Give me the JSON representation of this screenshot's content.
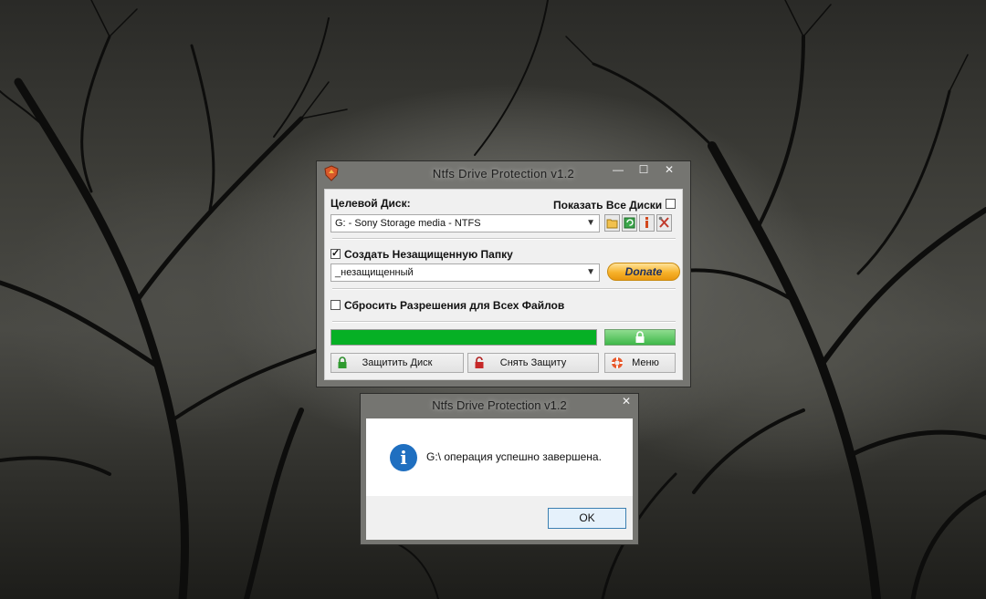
{
  "main_window": {
    "title": "Ntfs Drive Protection v1.2",
    "controls": {
      "minimize": "—",
      "maximize": "☐",
      "close": "✕"
    },
    "target_disk_label": "Целевой Диск:",
    "show_all_disks_label": "Показать Все Диски",
    "show_all_disks_checked": false,
    "disk_select_value": "G: - Sony Storage media - NTFS",
    "create_folder_label": "Создать Незащищенную Папку",
    "create_folder_checked": true,
    "folder_select_value": "_незащищенный",
    "donate_label": "Donate",
    "reset_permissions_label": "Сбросить Разрешения для Всех Файлов",
    "reset_permissions_checked": false,
    "progress_fraction": 1.0,
    "protect_button": "Защитить Диск",
    "unprotect_button": "Снять Защиту",
    "menu_button": "Меню"
  },
  "dialog": {
    "title": "Ntfs Drive Protection v1.2",
    "close": "✕",
    "message": "G:\\ операция успешно завершена.",
    "ok_button": "OK"
  },
  "colors": {
    "progress": "#06b025",
    "info": "#1f6fc0",
    "donate": "#f7b22a"
  }
}
